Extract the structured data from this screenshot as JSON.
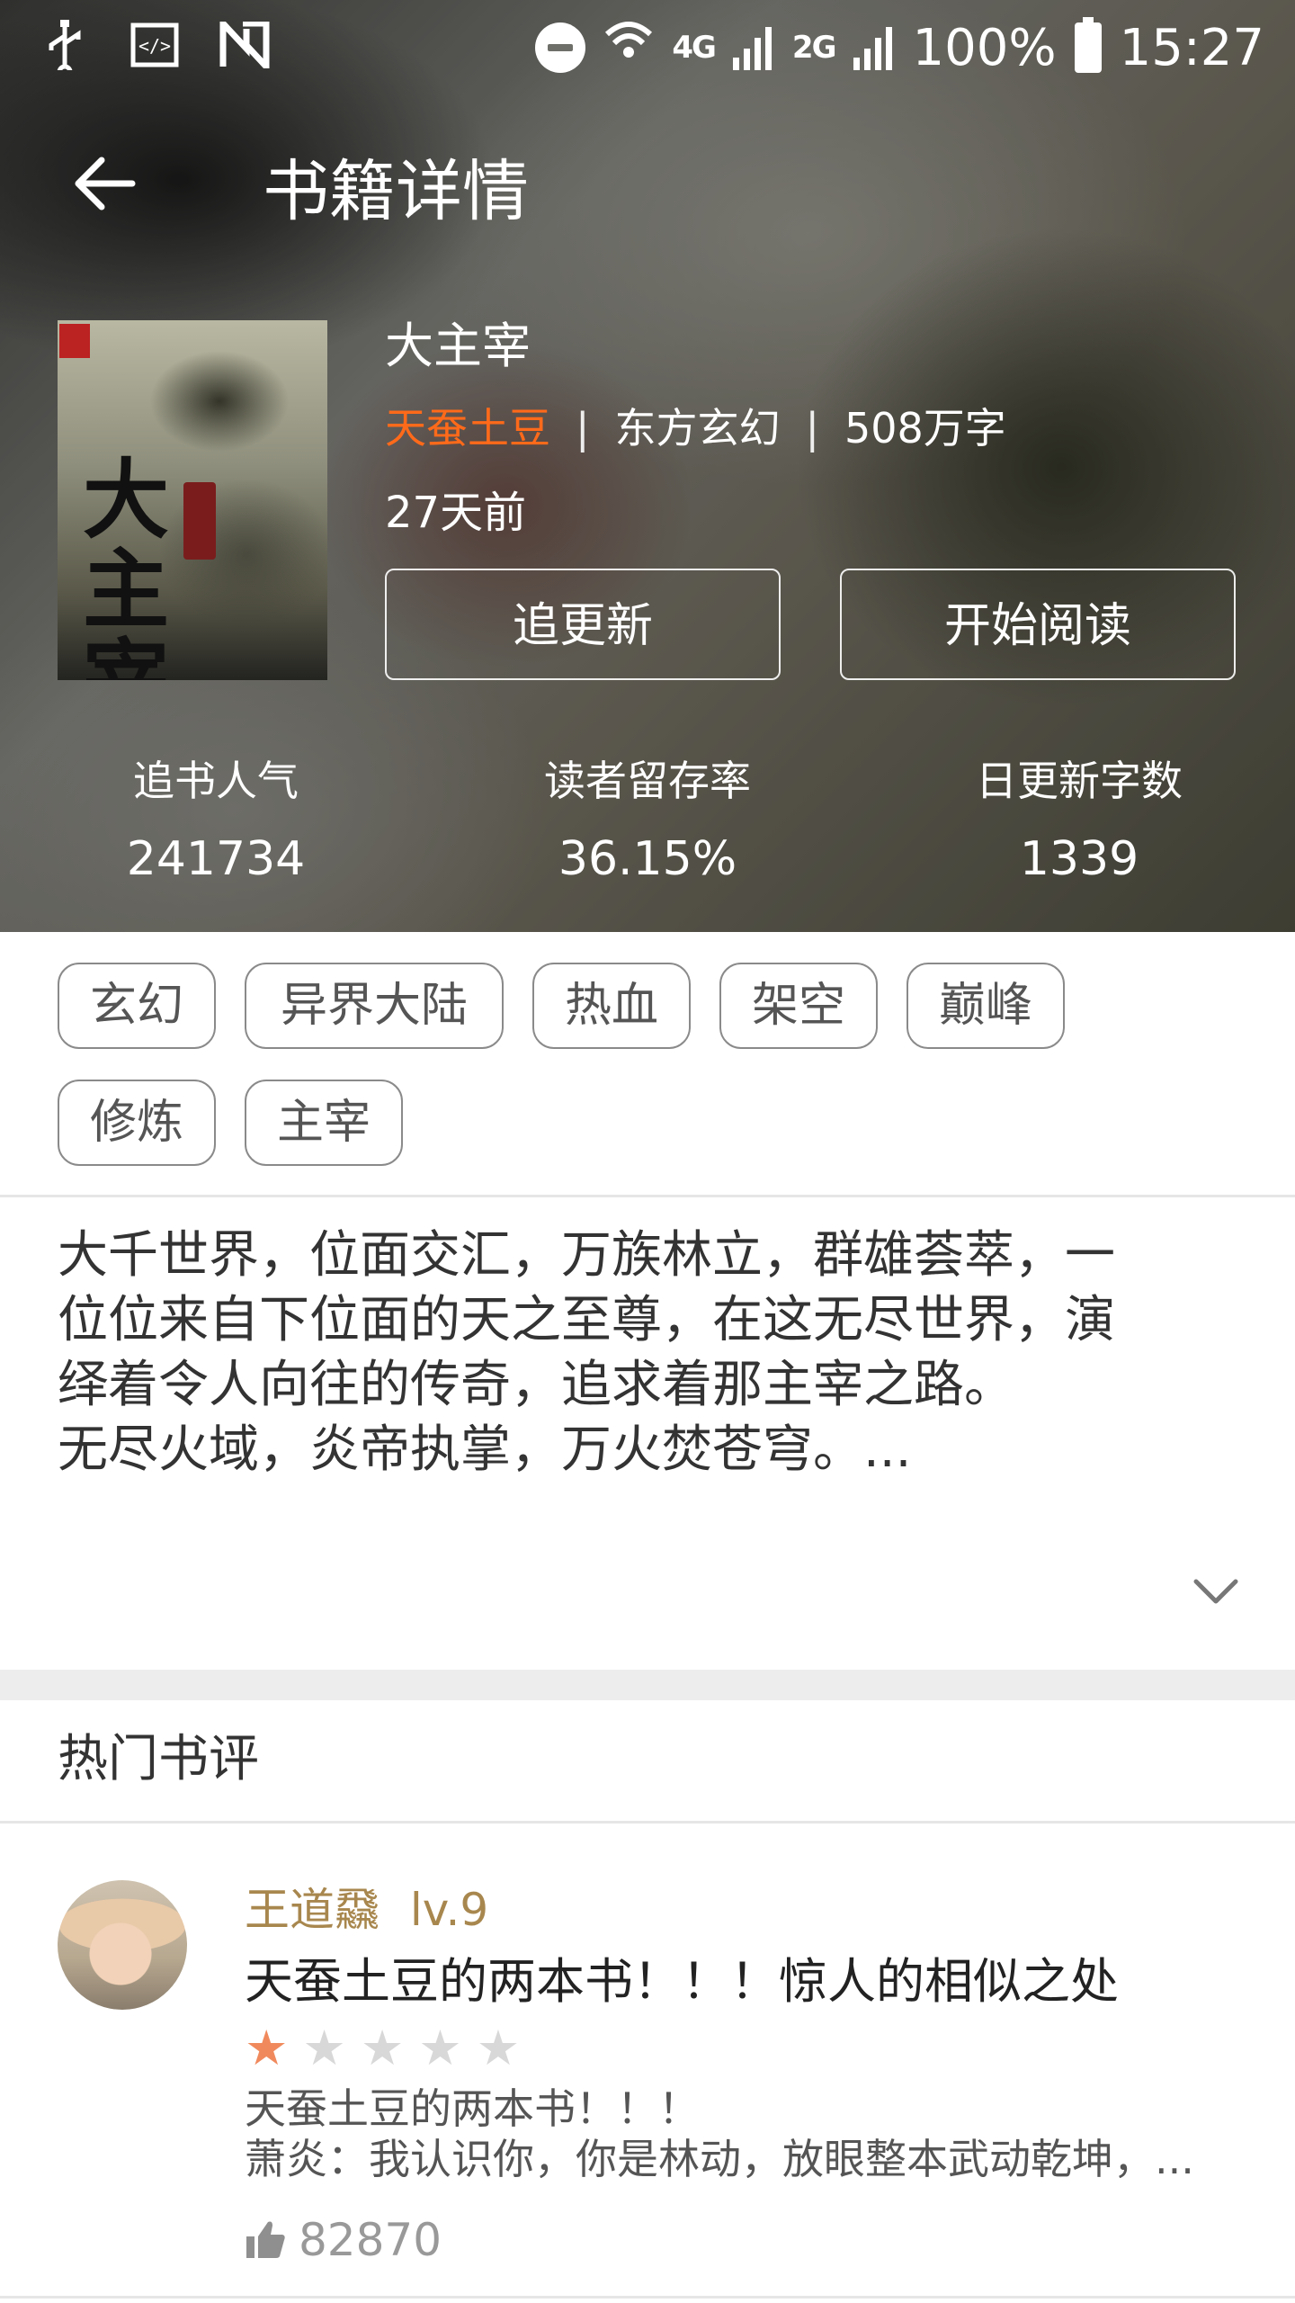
{
  "status_bar": {
    "left_icons": [
      "usb-icon",
      "code-icon",
      "nfc-icon"
    ],
    "right_icons": [
      "do-not-disturb-icon",
      "wifi-icon",
      "4g-signal-icon",
      "2g-signal-icon",
      "battery-icon"
    ],
    "network_1": "4G",
    "network_2": "2G",
    "battery": "100%",
    "time": "15:27"
  },
  "toolbar": {
    "back_icon": "←",
    "title": "书籍详情"
  },
  "book": {
    "title": "大主宰",
    "author": "天蚕土豆",
    "separator": "|",
    "category": "东方玄幻",
    "word_count": "508万字",
    "updated": "27天前",
    "cover_text": "大主宰",
    "follow_button": "追更新",
    "read_button": "开始阅读"
  },
  "stats": [
    {
      "label": "追书人气",
      "value": "241734"
    },
    {
      "label": "读者留存率",
      "value": "36.15%"
    },
    {
      "label": "日更新字数",
      "value": "1339"
    }
  ],
  "tags": [
    "玄幻",
    "异界大陆",
    "热血",
    "架空",
    "巅峰",
    "修炼",
    "主宰"
  ],
  "synopsis": {
    "lines": [
      "大千世界，位面交汇，万族林立，群雄荟萃，一",
      "位位来自下位面的天之至尊，在这无尽世界，演",
      "绎着令人向往的传奇，追求着那主宰之路。",
      "无尽火域，炎帝执掌，万火焚苍穹。..."
    ],
    "expand_icon": "⌄"
  },
  "reviews_section": {
    "title": "热门书评",
    "items": [
      {
        "user": "王道飝",
        "level": "lv.9",
        "title": "天蚕土豆的两本书！！！惊人的相似之处",
        "rating": 1,
        "rating_max": 5,
        "body_lines": [
          "天蚕土豆的两本书！！！",
          "萧炎：我认识你，你是林动，放眼整本武动乾坤，..."
        ],
        "likes": "82870"
      }
    ]
  }
}
